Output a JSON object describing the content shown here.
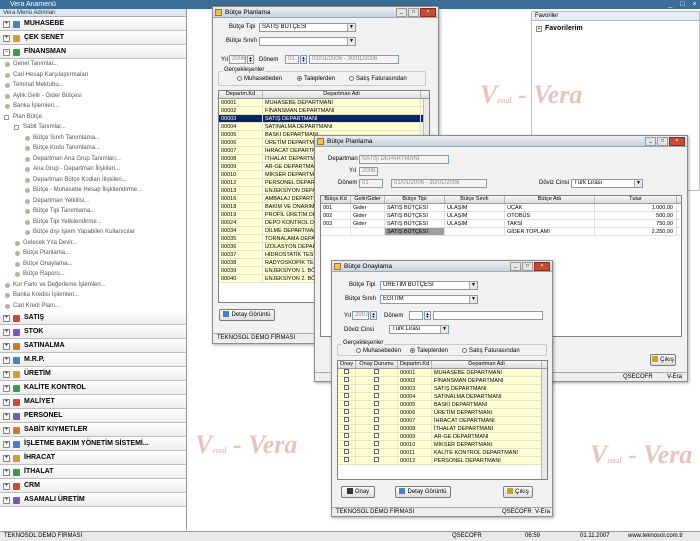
{
  "app": {
    "title": "Vera Anamenü"
  },
  "sidebar": {
    "header": "Vera Menü Adımları",
    "modules_top": [
      "MUHASEBE",
      "ÇEK SENET",
      "FİNANSMAN"
    ],
    "items": [
      "Genel Tanımlar...",
      "Cari Hesap Karşılaştırmaları",
      "Teminat Mektubu...",
      "Aylık Gelir - Gider Bütçesi",
      "Banka İşlemleri...",
      "Plan Bütçe"
    ],
    "subgroup": "Sabit Tanımlar...",
    "subitems": [
      "Bütçe Sınıfı Tanımlama...",
      "Bütçe Kodu Tanımlama...",
      "Departman Ana Grup Tanımları...",
      "Ana Grup - Departman İlişkileri...",
      "Departman Bütçe Kodları İlişkileri...",
      "Bütçe - Muhasebe Hesap İlişkilendirme...",
      "Departman Yetkilisi...",
      "Bütçe Tipi Tanımlama...",
      "Bütçe Tipi Yetkilendirme...",
      "Bütçe dışı İşlem Yapabilen Kullanıcılar"
    ],
    "plan_items": [
      "Gelecek Yıla Devir...",
      "Bütçe Planlama...",
      "Bütçe Onaylama...",
      "Bütçe Raporu..."
    ],
    "items_after": [
      "Kur Farkı ve Değerleme İşlemleri...",
      "Banka Kredisi İşlemleri...",
      "Cari Kredi Planı..."
    ],
    "modules_bottom": [
      "SATIŞ",
      "STOK",
      "SATINALMA",
      "M.R.P.",
      "ÜRETİM",
      "KALİTE KONTROL",
      "MALİYET",
      "PERSONEL",
      "SABİT KIYMETLER",
      "İŞLETME BAKIM YÖNETİM SİSTEMİ...",
      "İHRACAT",
      "İTHALAT",
      "CRM",
      "ASAMALI ÜRETİM"
    ]
  },
  "favorites": {
    "header": "Favoriler",
    "item": "Favorilerim"
  },
  "win1": {
    "title": "Bütçe Planlama",
    "butce_tipi_label": "Bütçe Tipi",
    "butce_tipi_value": "SATIŞ BÜTÇESİ",
    "butce_sinifi_label": "Bütçe Sınıfı",
    "butce_sinifi_value": "",
    "yil_label": "Yıl",
    "yil_value": "2006",
    "donem_label": "Dönem",
    "donem_value": "01",
    "donem_range": "01/01/2006 - 30/01/2006",
    "gercek_label": "Gerçekleşenler",
    "radio1": "Muhasebeden",
    "radio2": "Taleplerden",
    "radio3": "Satış Faturasından",
    "col_kod": "Departm.Kd",
    "col_adi": "Departman Adi",
    "rows": [
      {
        "kod": "00001",
        "adi": "MUHASEBE DEPARTMANI"
      },
      {
        "kod": "00002",
        "adi": "FİNANSMAN DEPARTMANI"
      },
      {
        "kod": "00003",
        "adi": "SATIŞ DEPARTMANI"
      },
      {
        "kod": "00004",
        "adi": "SATINALMA DEPARTMANI"
      },
      {
        "kod": "00005",
        "adi": "BASKI DEPARTMANI"
      },
      {
        "kod": "00006",
        "adi": "ÜRETİM DEPARTMANI"
      },
      {
        "kod": "00007",
        "adi": "İHRACAT DEPARTMANI"
      },
      {
        "kod": "00008",
        "adi": "İTHALAT DEPARTMANI"
      },
      {
        "kod": "00009",
        "adi": "AR-GE DEPARTMANI"
      },
      {
        "kod": "00010",
        "adi": "MİKSER DEPARTMANI"
      },
      {
        "kod": "00012",
        "adi": "PERSONEL DEPARTMANI"
      },
      {
        "kod": "00013",
        "adi": "ENJEKSİYON DEPARTMANI"
      },
      {
        "kod": "00016",
        "adi": "AMBALAJ DEPARTMANI"
      },
      {
        "kod": "00018",
        "adi": "BAKIM VE ONARIM"
      },
      {
        "kod": "00019",
        "adi": "PROFİL ÜRETİM DEPARTMANI"
      },
      {
        "kod": "00024",
        "adi": "DEPO KONTROL DEPARTMANI"
      },
      {
        "kod": "00034",
        "adi": "DİLME DEPARTMANI"
      },
      {
        "kod": "00035",
        "adi": "TORNALAMA DEPARTMANI"
      },
      {
        "kod": "00036",
        "adi": "İZOLASYON DEPARTMANI"
      },
      {
        "kod": "00037",
        "adi": "HİDROSTATİK TEST"
      },
      {
        "kod": "00038",
        "adi": "RADYOSKOPİK TEST"
      },
      {
        "kod": "00039",
        "adi": "ENJEKSİYON 1. BÖLÜM"
      },
      {
        "kod": "00040",
        "adi": "ENJEKSİYON 2. BÖLÜM"
      }
    ],
    "detay_btn": "Detay Görüntü",
    "status": "TEKNOSOL DEMO FİRMASI"
  },
  "win2": {
    "title": "Bütçe Planlama",
    "departman_label": "Departman",
    "departman_value": "SATIŞ DEPARTMANI",
    "yil_label": "Yıl",
    "yil_value": "2006",
    "donem_label": "Dönem",
    "donem_value": "01",
    "donem_range": "01/01/2006 - 30/01/2006",
    "doviz_label": "Döviz Cinsi",
    "doviz_value": "Türk Lirası",
    "cols": [
      "Bütçe.Kd",
      "Gelir/Gider",
      "Bütçe Tipi",
      "Bütçe Sınıfı",
      "Bütçe Adı",
      "Tutar"
    ],
    "rows": [
      {
        "kod": "001",
        "gg": "Gider",
        "tip": "SATIŞ BÜTÇESİ",
        "sinif": "ULAŞIM",
        "adi": "UÇAK",
        "tutar": "1.000,00"
      },
      {
        "kod": "002",
        "gg": "Gider",
        "tip": "SATIŞ BÜTÇESİ",
        "sinif": "ULAŞIM",
        "adi": "OTOBÜS",
        "tutar": "500,00"
      },
      {
        "kod": "003",
        "gg": "Gider",
        "tip": "SATIŞ BÜTÇESİ",
        "sinif": "ULAŞIM",
        "adi": "TAKSİ",
        "tutar": "750,00"
      }
    ],
    "total": {
      "tip": "SATIŞ BÜTÇESİ",
      "adi": "GİDER TOPLAMI",
      "tutar": "2.250,00"
    },
    "cikis_btn": "Çıkış",
    "status_right1": "QSECOFR",
    "status_right2": "V-Era"
  },
  "win3": {
    "title": "Bütçe Onaylama",
    "butce_tipi_label": "Bütçe Tipi",
    "butce_tipi_value": "ÜRETİM BÜTÇESİ",
    "butce_sinifi_label": "Bütçe Sınıfı",
    "butce_sinifi_value": "EĞİTİM",
    "yil_label": "Yıl",
    "yil_value": "2007",
    "donem_label": "Dönem",
    "donem_value": "",
    "doviz_label": "Döviz Cinsi",
    "doviz_value": "Türk Lirası",
    "gercek_label": "Gerçekleşenler",
    "radio1": "Muhasebeden",
    "radio2": "Taleplerden",
    "radio3": "Satış Faturasından",
    "cols": [
      "Onay",
      "Onay Durumu",
      "Departm.Kd",
      "Departman Adi"
    ],
    "rows": [
      {
        "kod": "00001",
        "adi": "MUHASEBE DEPARTMANI"
      },
      {
        "kod": "00002",
        "adi": "FİNANSMAN DEPARTMANI"
      },
      {
        "kod": "00003",
        "adi": "SATIŞ DEPARTMANI"
      },
      {
        "kod": "00004",
        "adi": "SATINALMA DEPARTMANI"
      },
      {
        "kod": "00005",
        "adi": "BASKI DEPARTMANI"
      },
      {
        "kod": "00006",
        "adi": "ÜRETİM DEPARTMANI"
      },
      {
        "kod": "00007",
        "adi": "İHRACAT DEPARTMANI"
      },
      {
        "kod": "00008",
        "adi": "İTHALAT DEPARTMANI"
      },
      {
        "kod": "00009",
        "adi": "AR-GE DEPARTMANI"
      },
      {
        "kod": "00010",
        "adi": "MİKSER DEPARTMANI"
      },
      {
        "kod": "00011",
        "adi": "KALİTE KONTROL DEPARTMANI"
      },
      {
        "kod": "00012",
        "adi": "PERSONEL DEPARTMANI"
      }
    ],
    "onay_btn": "Onay",
    "detay_btn": "Detay Görüntü",
    "cikis_btn": "Çıkış",
    "status": "TEKNOSOL DEMO FİRMASI",
    "status_user": "QSECOFR",
    "status_app": "V-Era"
  },
  "watermark": {
    "text": "V-Era",
    "sub": "by Migas",
    "brand": "Vera"
  },
  "statusbar": {
    "company": "TEKNOSOL DEMO FİRMASI",
    "user": "QSECOFR",
    "time": "06:59",
    "date": "01.11.2007",
    "url": "www.teknosol.com.tr"
  },
  "colors": {
    "selected_row": "#0a246a",
    "grid_yellow": "#ffffd2",
    "titlebar": "#3b6d97"
  }
}
